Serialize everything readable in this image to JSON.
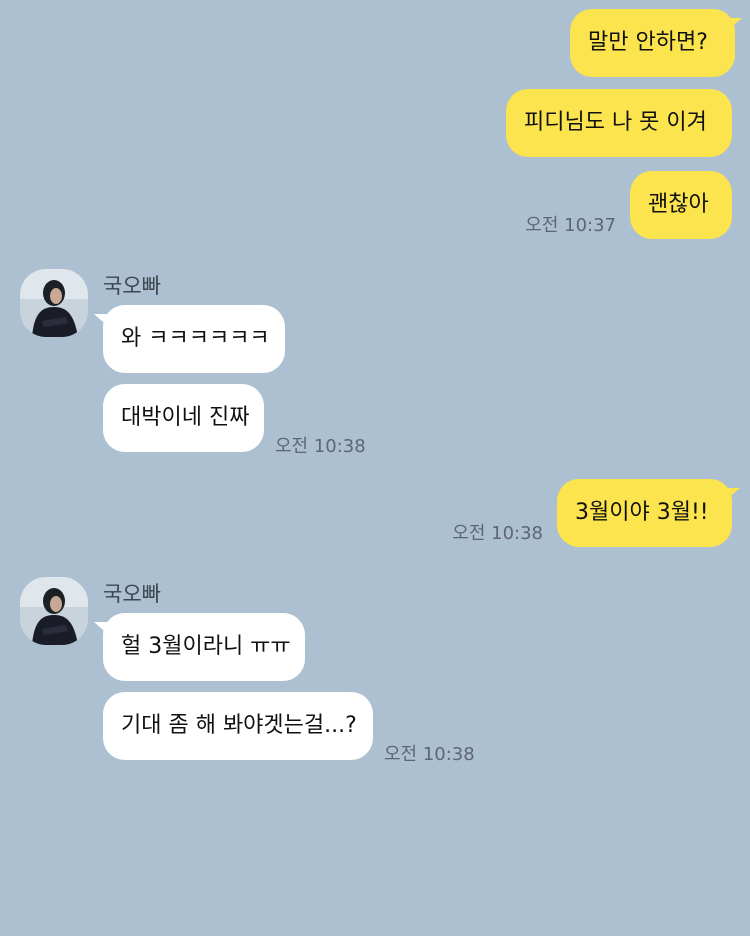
{
  "contact": {
    "name": "국오빠"
  },
  "messages": {
    "m1": "말만 안하면?",
    "m2": "피디님도 나 못 이겨",
    "m3": "괜찮아",
    "t3": "오전 10:37",
    "m4": "와 ㅋㅋㅋㅋㅋㅋ",
    "m5": "대박이네 진짜",
    "t5": "오전 10:38",
    "m6": "3월이야 3월!!",
    "t6": "오전 10:38",
    "m7": "헐 3월이라니 ㅠㅠ",
    "m8": "기대 좀 해 봐야겟는걸...?",
    "t8": "오전 10:38"
  },
  "colors": {
    "background": "#adc0d2",
    "sent_bubble": "#fbe44d",
    "received_bubble": "#ffffff",
    "timestamp": "#5d6772"
  },
  "icons": {
    "avatar": "profile-photo"
  }
}
